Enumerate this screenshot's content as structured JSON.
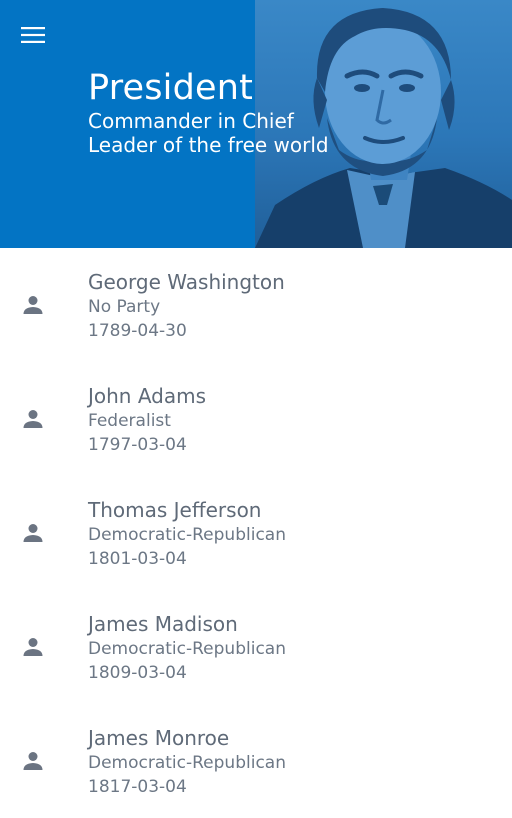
{
  "header": {
    "title": "President",
    "subtitle_1": "Commander in Chief",
    "subtitle_2": "Leader of the free world",
    "menu_icon": "menu-icon",
    "background_color": "#0374c4"
  },
  "presidents": [
    {
      "name": "George Washington",
      "party": "No Party",
      "date": "1789-04-30"
    },
    {
      "name": "John Adams",
      "party": "Federalist",
      "date": "1797-03-04"
    },
    {
      "name": "Thomas Jefferson",
      "party": "Democratic-Republican",
      "date": "1801-03-04"
    },
    {
      "name": "James Madison",
      "party": "Democratic-Republican",
      "date": "1809-03-04"
    },
    {
      "name": "James Monroe",
      "party": "Democratic-Republican",
      "date": "1817-03-04"
    }
  ],
  "list_icon": "person-icon",
  "colors": {
    "text_primary": "#5f6a78",
    "text_secondary": "#6c7785",
    "icon": "#6b7482"
  }
}
